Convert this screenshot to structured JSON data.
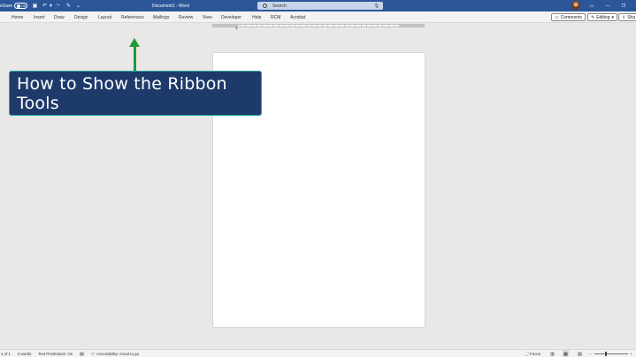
{
  "titlebar": {
    "autosave_label": "eSave",
    "autosave_state": "Off",
    "document_title": "Document1 - Word",
    "search_placeholder": "Search",
    "bg_color": "#2b579a"
  },
  "ribbon_tabs": [
    "Home",
    "Insert",
    "Draw",
    "Design",
    "Layout",
    "References",
    "Mailings",
    "Review",
    "View",
    "Developer",
    "Help",
    "RCM",
    "Acrobat"
  ],
  "ribbon_right": {
    "comments_label": "Comments",
    "editing_label": "Editing",
    "share_label": "Sha"
  },
  "overlay": {
    "callout_text": "How to Show the Ribbon Tools",
    "arrow_color": "#1e9b3a",
    "callout_color": "#1e3a6a"
  },
  "statusbar": {
    "page_info": "1 of 1",
    "word_count": "0 words",
    "text_predictions": "Text Predictions: On",
    "accessibility": "Accessibility: Good to go",
    "focus_label": "Focus"
  }
}
